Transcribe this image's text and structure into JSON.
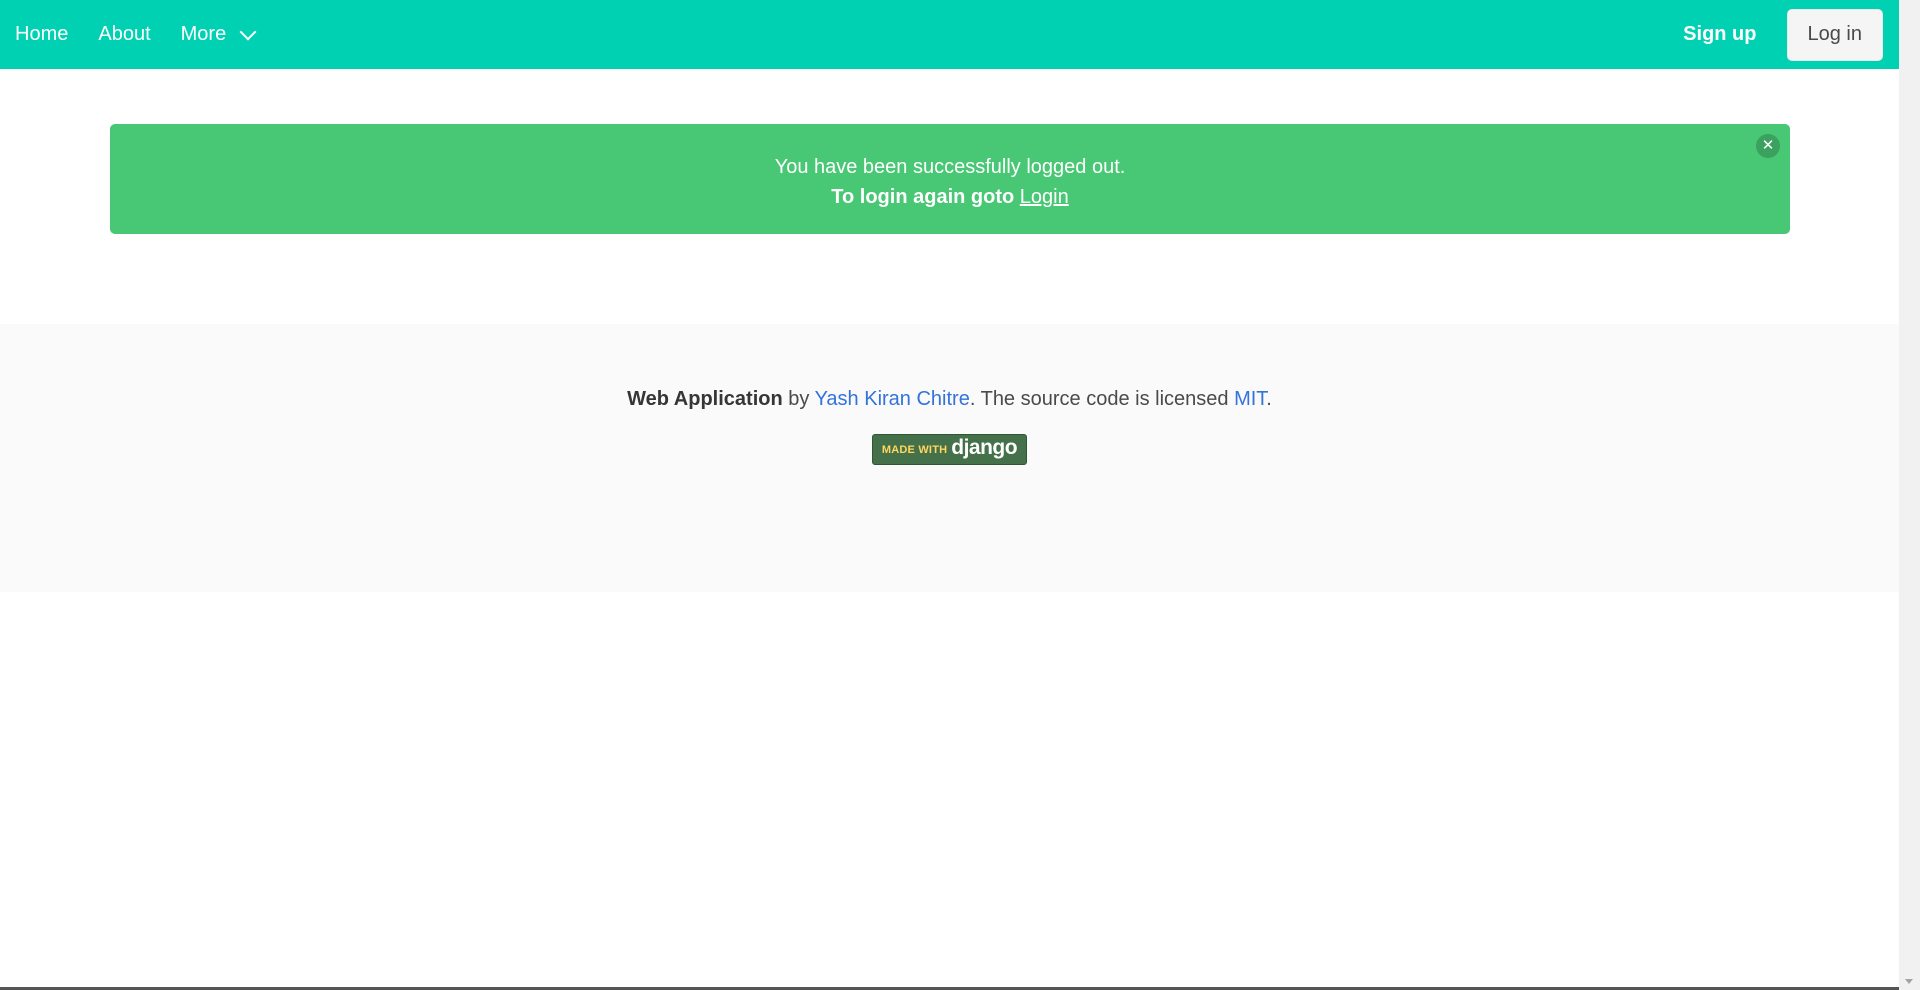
{
  "navbar": {
    "items": [
      {
        "label": "Home"
      },
      {
        "label": "About"
      },
      {
        "label": "More"
      }
    ],
    "signup_label": "Sign up",
    "login_label": "Log in",
    "background_color": "#00d1b2"
  },
  "notification": {
    "message": "You have been successfully logged out.",
    "prompt": "To login again goto",
    "link_label": "Login",
    "close_icon": "close-icon",
    "background_color": "#48c774"
  },
  "footer": {
    "app_name": "Web Application",
    "by_text": "by",
    "author": "Yash Kiran Chitre",
    "license_text": ". The source code is licensed",
    "license": "MIT",
    "end": ".",
    "badge": {
      "small_text": "MADE WITH",
      "big_text": "django"
    }
  }
}
